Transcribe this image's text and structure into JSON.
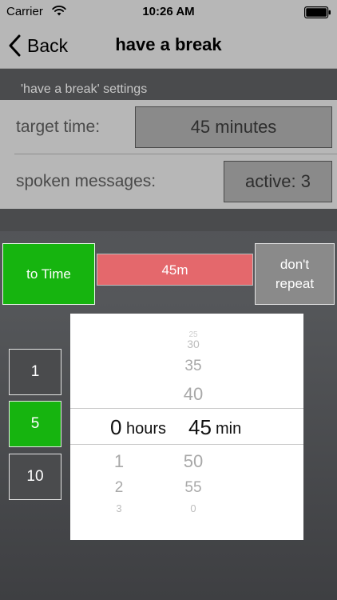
{
  "status_bar": {
    "carrier": "Carrier",
    "time": "10:26 AM",
    "wifi_icon": "wifi-icon",
    "battery_icon": "battery-icon"
  },
  "nav": {
    "back_label": "Back",
    "title": "have a break"
  },
  "settings": {
    "header": "'have a break' settings",
    "target_label": "target time:",
    "target_value": "45 minutes",
    "spoken_label": "spoken messages:",
    "spoken_value": "active: 3"
  },
  "controls": {
    "to_time_label": "to Time",
    "progress_label": "45m",
    "progress_fraction": 1.0,
    "dont_repeat_label": "don't\nrepeat",
    "steps": [
      "1",
      "5",
      "10"
    ],
    "selected_step": "5"
  },
  "picker": {
    "hours": {
      "above": [],
      "selected": "0",
      "below": [
        "1",
        "2",
        "3"
      ],
      "unit": "hours"
    },
    "minutes": {
      "above": [
        "25",
        "30",
        "35",
        "40"
      ],
      "selected": "45",
      "below": [
        "50",
        "55",
        "0"
      ],
      "unit": "min"
    }
  },
  "colors": {
    "accent_green": "#16b40f",
    "progress_red": "#e4686c",
    "panel_gray": "#b7b7b7",
    "dark_gray": "#4a4b4d"
  }
}
